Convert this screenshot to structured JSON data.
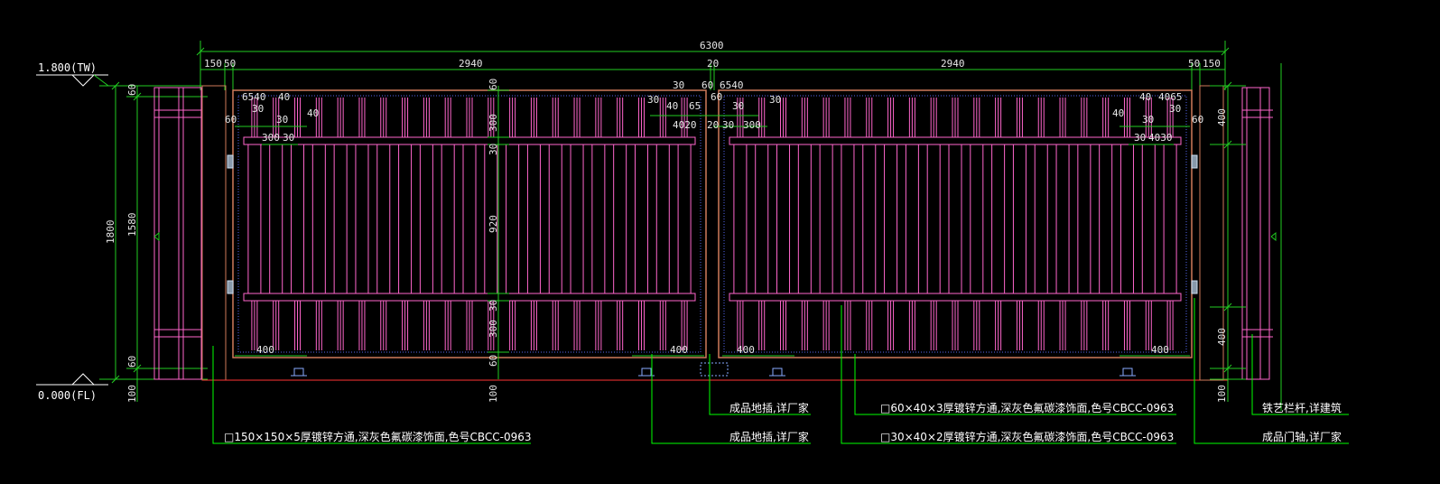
{
  "levels": {
    "top": "1.800(TW)",
    "bottom": "0.000(FL)"
  },
  "overall_dim": "6300",
  "top_dims": [
    "150",
    "50",
    "2940",
    "20",
    "2940",
    "50",
    "150"
  ],
  "left_dims": {
    "total": "1800",
    "inner": "1580",
    "top": "60",
    "bottom": "60",
    "below": "100"
  },
  "mid_dims": [
    "60",
    "300",
    "30",
    "920",
    "30",
    "300",
    "60",
    "100"
  ],
  "right_dims": {
    "top": "400",
    "bottom": "400",
    "below": "100"
  },
  "detail_dims": {
    "left_leaf": {
      "a": "6540",
      "b": "40",
      "c": "30",
      "d": "30",
      "e": "40",
      "f": "60",
      "g": "300",
      "h": "30"
    },
    "center": {
      "a": "30",
      "b": "60",
      "c": "6540",
      "d": "60",
      "e": "30",
      "f": "30",
      "g": "40",
      "h": "65",
      "i": "4020",
      "j": "20",
      "k": "30",
      "l": "300",
      "m": "30"
    },
    "right_leaf": {
      "a": "40",
      "b": "4065",
      "c": "30",
      "d": "40",
      "e": "30",
      "f": "60",
      "g": "30",
      "h": "4030"
    },
    "bottom": [
      "400",
      "400",
      "400",
      "400"
    ]
  },
  "callouts": {
    "post": "□150×150×5厚镀锌方通,深灰色氟碳漆饰面,色号CBCC-0963",
    "floor_stop_1": "成品地插,详厂家",
    "floor_stop_2": "成品地插,详厂家",
    "frame": "□60×40×3厚镀锌方通,深灰色氟碳漆饰面,色号CBCC-0963",
    "bar": "□30×40×2厚镀锌方通,深灰色氟碳漆饰面,色号CBCC-0963",
    "railing": "铁艺栏杆,详建筑",
    "pivot": "成品门轴,详厂家"
  },
  "colors": {
    "dim": "#22cc22",
    "frame": "#ff66cc",
    "post": "#d07a5a",
    "fill": "#5566ee",
    "callout": "#00ff00"
  }
}
